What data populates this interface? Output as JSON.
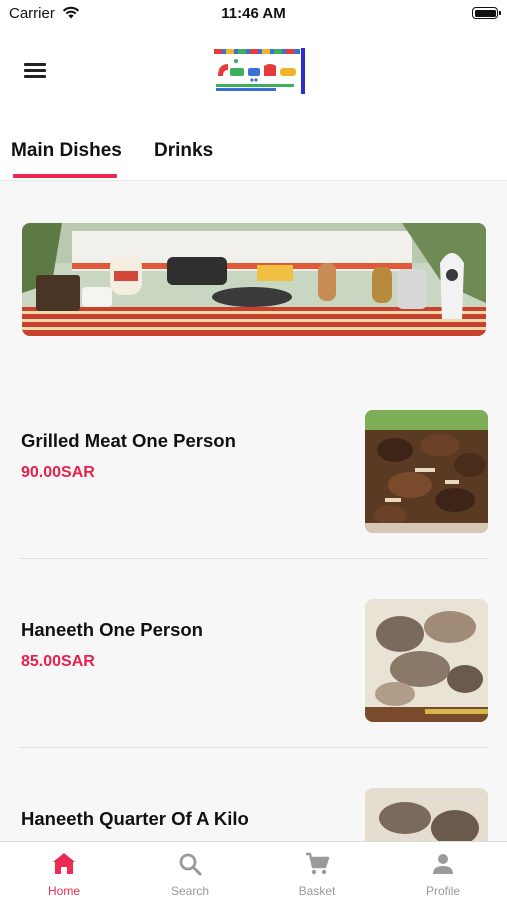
{
  "status_bar": {
    "carrier": "Carrier",
    "time": "11:46 AM"
  },
  "header": {
    "logo_icon": "restaurant-logo",
    "menu_icon": "hamburger-menu-icon"
  },
  "tabs": [
    {
      "label": "Main Dishes",
      "active": true
    },
    {
      "label": "Drinks",
      "active": false
    }
  ],
  "dishes": [
    {
      "name": "Grilled Meat One Person",
      "price": "90.00SAR"
    },
    {
      "name": "Haneeth One Person",
      "price": "85.00SAR"
    },
    {
      "name": "Haneeth Quarter Of A Kilo",
      "price": ""
    }
  ],
  "bottom_nav": [
    {
      "label": "Home",
      "icon": "home-icon",
      "active": true
    },
    {
      "label": "Search",
      "icon": "search-icon",
      "active": false
    },
    {
      "label": "Basket",
      "icon": "cart-icon",
      "active": false
    },
    {
      "label": "Profile",
      "icon": "profile-icon",
      "active": false
    }
  ],
  "colors": {
    "accent": "#ee2a50",
    "price": "#e8204c",
    "inactive": "#9a9a9a",
    "background": "#f7f7f7"
  }
}
